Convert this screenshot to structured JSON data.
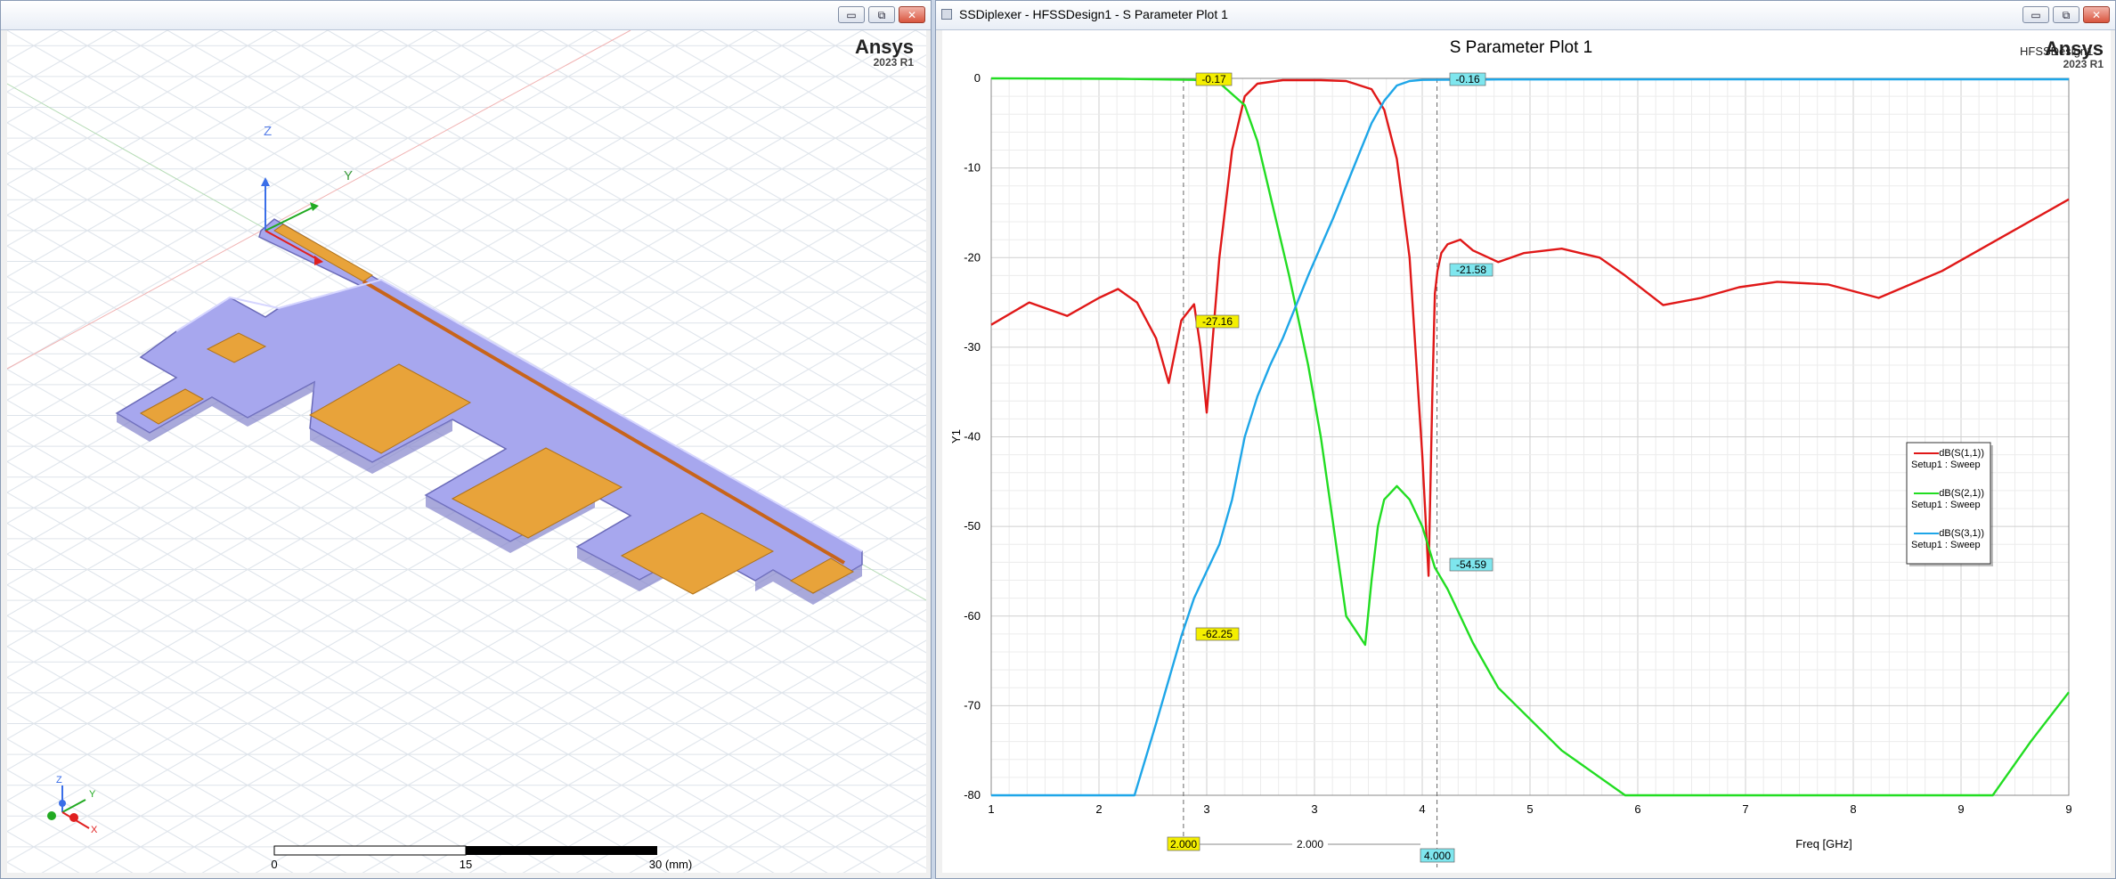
{
  "left_window": {
    "brand": "Ansys",
    "brand_version": "2023 R1",
    "axis_labels": {
      "z": "Z",
      "y": "Y",
      "x": "X"
    },
    "scale_bar": {
      "ticks": [
        "0",
        "15",
        "30 (mm)"
      ]
    },
    "colors": {
      "substrate": "#9e9ee6",
      "metal": "#e8a33a",
      "background": "#ffffff"
    }
  },
  "right_window": {
    "title": "SSDiplexer - HFSSDesign1 - S Parameter Plot 1",
    "brand": "Ansys",
    "brand_version": "2023 R1",
    "design_name": "HFSSDesign1",
    "markers": {
      "top_left": "-0.17",
      "top_right": "-0.16",
      "s11_left": "-27.16",
      "s11_right": "-21.58",
      "s21_right": "-54.59",
      "s31_left": "-62.25",
      "x_left": "2.000",
      "x_right": "4.000",
      "delta": "2.000"
    },
    "window_buttons": {
      "minimize": "▭",
      "restore": "⧉",
      "close": "✕"
    }
  },
  "chart_data": {
    "type": "line",
    "title": "S Parameter Plot 1",
    "xlabel": "Freq [GHz]",
    "ylabel": "Y1",
    "xlim": [
      1,
      9.5
    ],
    "ylim": [
      -80,
      0
    ],
    "x_ticks": [
      "1",
      "2",
      "3",
      "3",
      "4",
      "5",
      "6",
      "7",
      "8",
      "9",
      "9"
    ],
    "y_ticks": [
      "0",
      "-10",
      "-20",
      "-30",
      "-40",
      "-50",
      "-60",
      "-70",
      "-80"
    ],
    "grid": true,
    "legend": "right",
    "series": [
      {
        "name": "dB(S(1,1))",
        "sweep": "Setup1 : Sweep",
        "color": "#e01818",
        "x": [
          1.0,
          1.3,
          1.6,
          1.85,
          2.0,
          2.15,
          2.3,
          2.4,
          2.5,
          2.6,
          2.65,
          2.7,
          2.8,
          2.9,
          3.0,
          3.1,
          3.3,
          3.6,
          3.8,
          4.0,
          4.1,
          4.2,
          4.3,
          4.4,
          4.45,
          4.48,
          4.5,
          4.52,
          4.55,
          4.6,
          4.7,
          4.8,
          5.0,
          5.2,
          5.5,
          5.8,
          6.0,
          6.3,
          6.6,
          6.9,
          7.2,
          7.6,
          8.0,
          8.5,
          9.0,
          9.5
        ],
        "y": [
          -27.5,
          -25,
          -26.5,
          -24.5,
          -23.5,
          -25,
          -29,
          -34,
          -27,
          -25.2,
          -30,
          -37.3,
          -20,
          -8,
          -2,
          -0.6,
          -0.2,
          -0.2,
          -0.3,
          -1.2,
          -3.5,
          -9,
          -20,
          -42,
          -55.5,
          -35,
          -24,
          -21.5,
          -19.5,
          -18.5,
          -18,
          -19.2,
          -20.5,
          -19.5,
          -19,
          -20,
          -22,
          -25.3,
          -24.5,
          -23.3,
          -22.7,
          -23,
          -24.5,
          -21.5,
          -17.5,
          -13.5
        ]
      },
      {
        "name": "dB(S(2,1))",
        "sweep": "Setup1 : Sweep",
        "color": "#22dd22",
        "x": [
          1.0,
          2.0,
          2.3,
          2.6,
          2.8,
          3.0,
          3.1,
          3.2,
          3.35,
          3.5,
          3.6,
          3.7,
          3.8,
          3.95,
          4.0,
          4.05,
          4.1,
          4.2,
          4.3,
          4.4,
          4.5,
          4.6,
          4.8,
          5.0,
          5.5,
          6.0,
          6.3,
          8.9,
          9.2,
          9.5
        ],
        "y": [
          0,
          -0.05,
          -0.1,
          -0.17,
          -0.5,
          -3,
          -7,
          -13,
          -22,
          -32,
          -40,
          -50,
          -60,
          -63.2,
          -56,
          -50,
          -47,
          -45.5,
          -47,
          -50,
          -54.6,
          -57,
          -63,
          -68,
          -75,
          -80,
          -80,
          -80,
          -74,
          -68.5
        ]
      },
      {
        "name": "dB(S(3,1))",
        "sweep": "Setup1 : Sweep",
        "color": "#1ea6e8",
        "x": [
          1.0,
          2.13,
          2.3,
          2.5,
          2.6,
          2.7,
          2.8,
          2.9,
          3.0,
          3.1,
          3.2,
          3.3,
          3.5,
          3.7,
          3.9,
          4.0,
          4.1,
          4.2,
          4.3,
          4.4,
          4.5,
          5.0,
          7.0,
          9.5
        ],
        "y": [
          -80,
          -80,
          -72,
          -62.25,
          -58,
          -55,
          -52,
          -47,
          -40,
          -35.5,
          -32,
          -29,
          -22,
          -15.5,
          -8.5,
          -5,
          -2.5,
          -0.8,
          -0.3,
          -0.17,
          -0.16,
          -0.12,
          -0.1,
          -0.1
        ]
      }
    ]
  }
}
